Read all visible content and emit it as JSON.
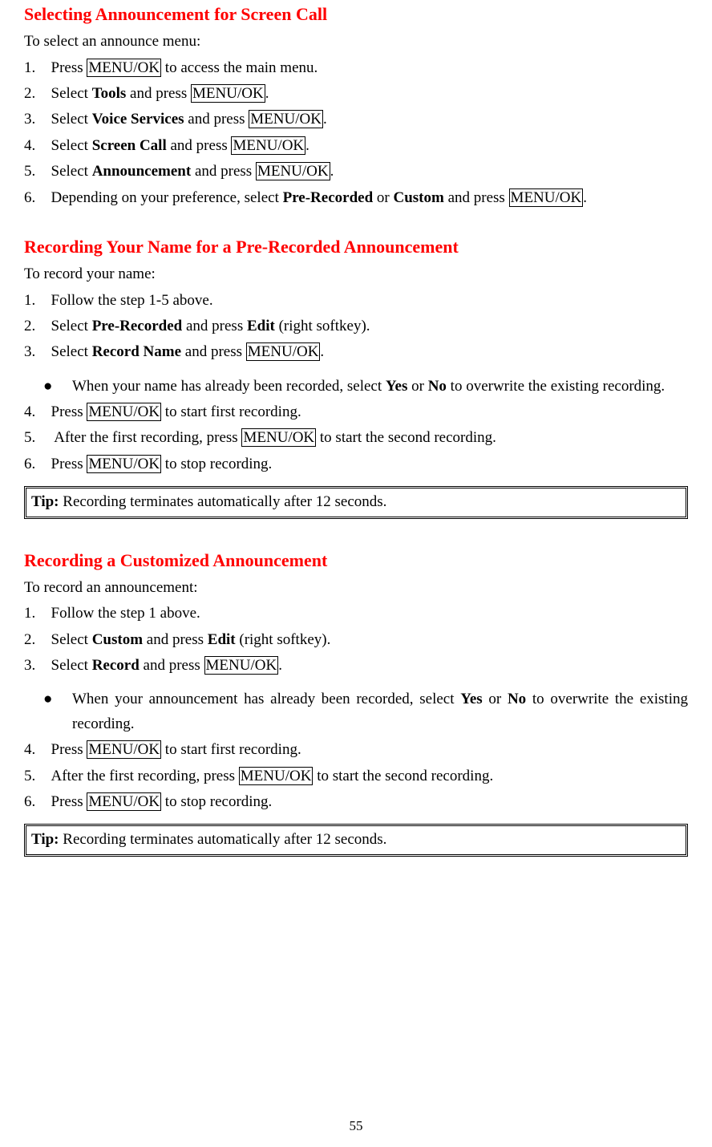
{
  "section1": {
    "heading": "Selecting Announcement for Screen Call",
    "intro": "To select an announce menu:",
    "steps": {
      "s1a": "Press ",
      "s1k": "MENU/OK",
      "s1b": " to access the main menu.",
      "s2a": "Select ",
      "s2b": "Tools",
      "s2c": " and press ",
      "s2k": "MENU/OK",
      "s2d": ".",
      "s3a": "Select ",
      "s3b": "Voice Services",
      "s3c": " and press ",
      "s3k": "MENU/OK",
      "s3d": ".",
      "s4a": "Select ",
      "s4b": "Screen Call",
      "s4c": " and press ",
      "s4k": "MENU/OK",
      "s4d": ".",
      "s5a": "Select ",
      "s5b": "Announcement",
      "s5c": " and press ",
      "s5k": "MENU/OK",
      "s5d": ".",
      "s6a": "Depending on your preference, select ",
      "s6b": "Pre-Recorded",
      "s6c": " or ",
      "s6d": "Custom",
      "s6e": " and press ",
      "s6k": "MENU/OK",
      "s6f": "."
    }
  },
  "section2": {
    "heading": "Recording Your Name for a Pre-Recorded Announcement",
    "intro": "To record your name:",
    "steps": {
      "s1": "Follow the step 1-5 above.",
      "s2a": "Select ",
      "s2b": "Pre-Recorded",
      "s2c": " and press ",
      "s2d": "Edit",
      "s2e": " (right softkey).",
      "s3a": "Select ",
      "s3b": "Record Name",
      "s3c": " and press ",
      "s3k": "MENU/OK",
      "s3d": ".",
      "bul_a": "When your name has already been recorded, select ",
      "bul_b": "Yes",
      "bul_c": " or ",
      "bul_d": "No",
      "bul_e": " to overwrite the existing recording.",
      "s4a": "Press ",
      "s4k": "MENU/OK",
      "s4b": " to start first recording.",
      "s5a": " After the first recording, press ",
      "s5k": "MENU/OK",
      "s5b": " to start the second recording.",
      "s6a": "Press ",
      "s6k": "MENU/OK",
      "s6b": " to stop recording."
    },
    "tip_label": "Tip:",
    "tip_text": " Recording terminates automatically after 12 seconds."
  },
  "section3": {
    "heading": "Recording a Customized Announcement",
    "intro": "To record an announcement:",
    "steps": {
      "s1": "Follow the step 1 above.",
      "s2a": "Select ",
      "s2b": "Custom",
      "s2c": " and press ",
      "s2d": "Edit",
      "s2e": " (right softkey).",
      "s3a": "Select ",
      "s3b": "Record",
      "s3c": " and press ",
      "s3k": "MENU/OK",
      "s3d": ".",
      "bul_a": "When your announcement has already been recorded, select ",
      "bul_b": "Yes",
      "bul_c": " or ",
      "bul_d": "No",
      "bul_e": " to overwrite the existing recording.",
      "s4a": "Press ",
      "s4k": "MENU/OK",
      "s4b": " to start first recording.",
      "s5a": "After the first recording, press ",
      "s5k": "MENU/OK",
      "s5b": " to start the second recording.",
      "s6a": "Press ",
      "s6k": "MENU/OK",
      "s6b": " to stop recording."
    },
    "tip_label": "Tip:",
    "tip_text": " Recording terminates automatically after 12 seconds."
  },
  "page_number": "55"
}
